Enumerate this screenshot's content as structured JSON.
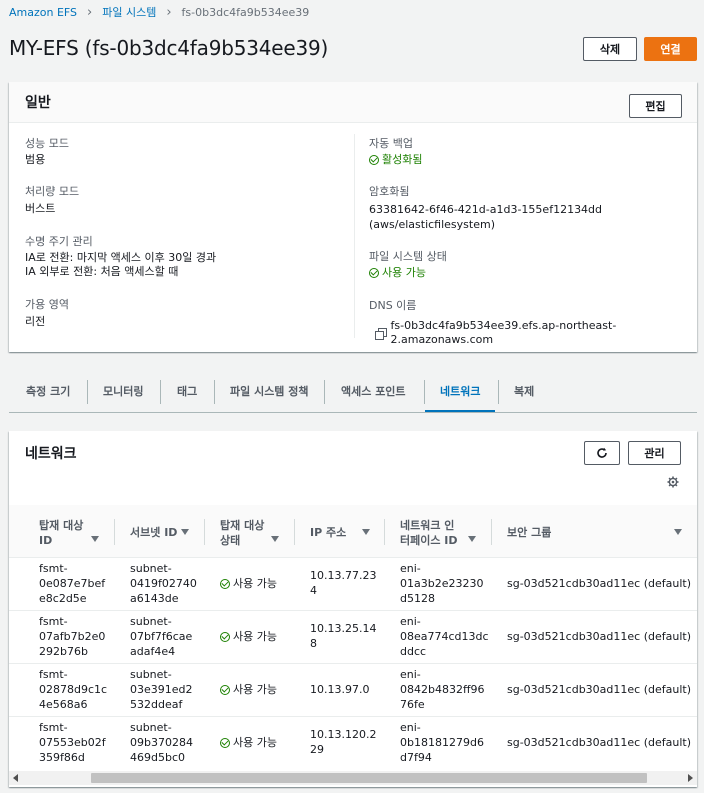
{
  "breadcrumb": {
    "service": "Amazon EFS",
    "section": "파일 시스템",
    "current": "fs-0b3dc4fa9b534ee39"
  },
  "page": {
    "title": "MY-EFS (fs-0b3dc4fa9b534ee39)",
    "delete_label": "삭제",
    "connect_label": "연결"
  },
  "general": {
    "title": "일반",
    "edit_label": "편집",
    "performance_mode_label": "성능 모드",
    "performance_mode_value": "범용",
    "throughput_mode_label": "처리량 모드",
    "throughput_mode_value": "버스트",
    "lifecycle_label": "수명 주기 관리",
    "lifecycle_line1": "IA로 전환: 마지막 액세스 이후 30일 경과",
    "lifecycle_line2": "IA 외부로 전환: 처음 액세스할 때",
    "availability_label": "가용 영역",
    "availability_value": "리전",
    "auto_backup_label": "자동 백업",
    "auto_backup_value": "활성화됨",
    "encryption_label": "암호화됨",
    "encryption_key": "63381642-6f46-421d-a1d3-155ef12134dd",
    "encryption_alias": "(aws/elasticfilesystem)",
    "fs_state_label": "파일 시스템 상태",
    "fs_state_value": "사용 가능",
    "dns_label": "DNS 이름",
    "dns_value": "fs-0b3dc4fa9b534ee39.efs.ap-northeast-2.amazonaws.com"
  },
  "tabs": [
    {
      "label": "측정 크기"
    },
    {
      "label": "모니터링"
    },
    {
      "label": "태그"
    },
    {
      "label": "파일 시스템 정책"
    },
    {
      "label": "액세스 포인트"
    },
    {
      "label": "네트워크"
    },
    {
      "label": "복제"
    }
  ],
  "network": {
    "title": "네트워크",
    "manage_label": "관리",
    "columns": [
      {
        "l1": "탑재 대상",
        "l2": "ID"
      },
      {
        "l1": "서브넷 ID",
        "l2": ""
      },
      {
        "l1": "탑재 대상",
        "l2": "상태"
      },
      {
        "l1": "IP 주소",
        "l2": ""
      },
      {
        "l1": "네트워크 인",
        "l2": "터페이스 ID"
      },
      {
        "l1": "보안 그룹",
        "l2": ""
      }
    ],
    "rows": [
      {
        "mt": [
          "fsmt-",
          "0e087e7bef",
          "e8c2d5e"
        ],
        "subnet": [
          "subnet-",
          "0419f02740",
          "a6143de"
        ],
        "state": "사용 가능",
        "ip": [
          "10.13.77.23",
          "4"
        ],
        "eni": [
          "eni-",
          "01a3b2e23230",
          "d5128"
        ],
        "sg": "sg-03d521cdb30ad11ec (default)"
      },
      {
        "mt": [
          "fsmt-",
          "07afb7b2e0",
          "292b76b"
        ],
        "subnet": [
          "subnet-",
          "07bf7f6cae",
          "adaf4e4"
        ],
        "state": "사용 가능",
        "ip": [
          "10.13.25.14",
          "8"
        ],
        "eni": [
          "eni-",
          "08ea774cd13dc",
          "ddcc"
        ],
        "sg": "sg-03d521cdb30ad11ec (default)"
      },
      {
        "mt": [
          "fsmt-",
          "02878d9c1c",
          "4e568a6"
        ],
        "subnet": [
          "subnet-",
          "03e391ed2",
          "532ddeaf"
        ],
        "state": "사용 가능",
        "ip": [
          "10.13.97.0",
          ""
        ],
        "eni": [
          "eni-",
          "0842b4832ff96",
          "76fe"
        ],
        "sg": "sg-03d521cdb30ad11ec (default)"
      },
      {
        "mt": [
          "fsmt-",
          "07553eb02f",
          "359f86d"
        ],
        "subnet": [
          "subnet-",
          "09b370284",
          "469d5bc0"
        ],
        "state": "사용 가능",
        "ip": [
          "10.13.120.2",
          "29"
        ],
        "eni": [
          "eni-",
          "0b18181279d6",
          "d7f94"
        ],
        "sg": "sg-03d521cdb30ad11ec (default)"
      }
    ]
  },
  "colors": {
    "accent": "#0073bb",
    "primary_button": "#ec7211",
    "success": "#1d8102"
  }
}
